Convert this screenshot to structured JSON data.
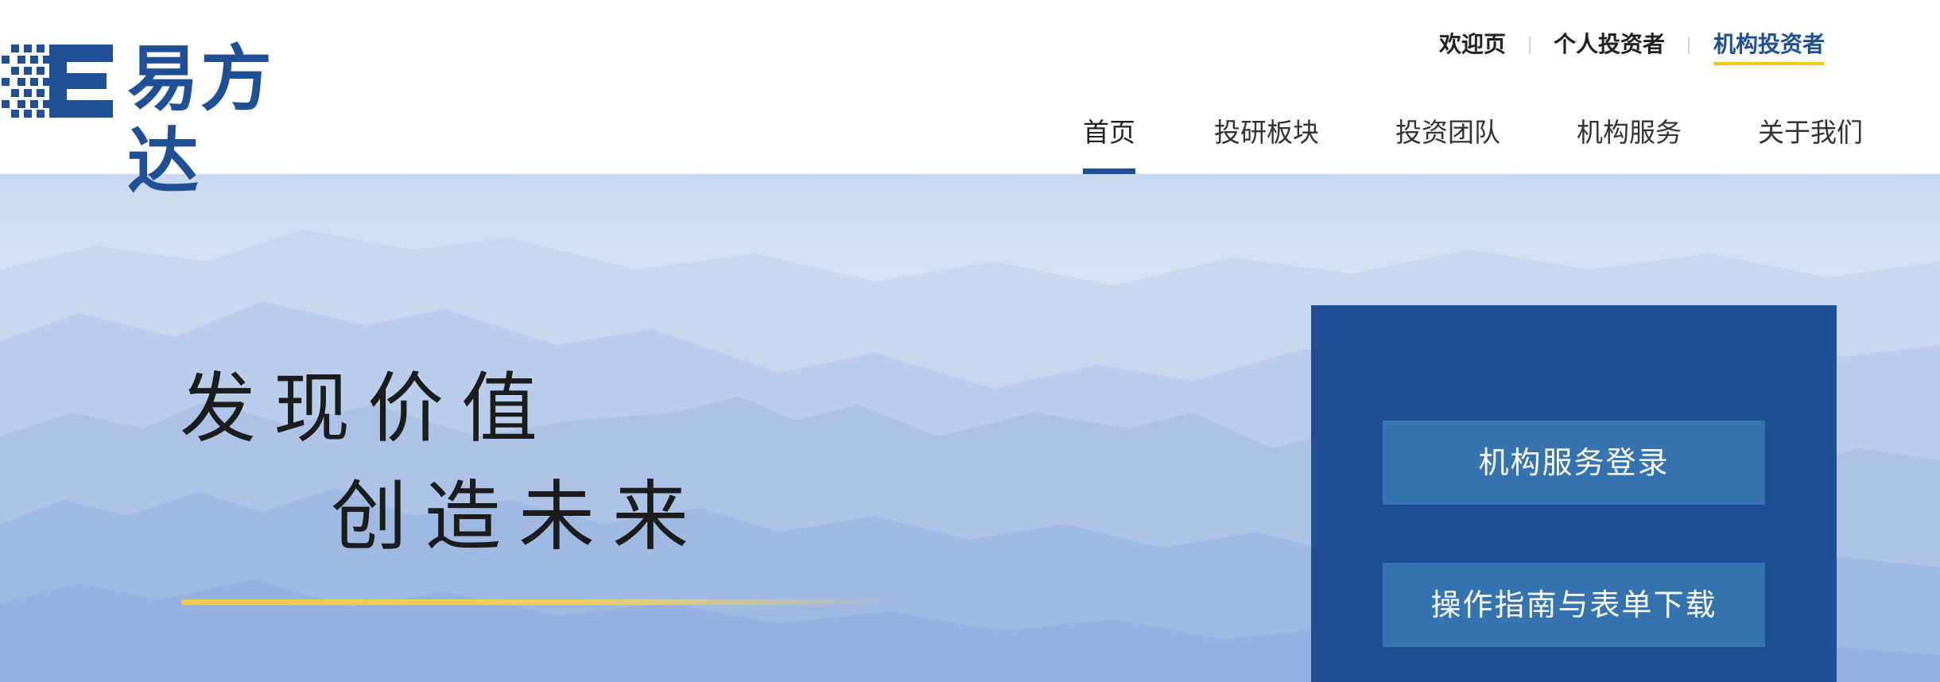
{
  "brand": {
    "name": "易方达",
    "color": "#1f4f95"
  },
  "top_links": [
    {
      "label": "欢迎页",
      "active": false
    },
    {
      "label": "个人投资者",
      "active": false
    },
    {
      "label": "机构投资者",
      "active": true
    }
  ],
  "main_nav": [
    {
      "label": "首页",
      "active": true
    },
    {
      "label": "投研板块",
      "active": false
    },
    {
      "label": "投资团队",
      "active": false
    },
    {
      "label": "机构服务",
      "active": false
    },
    {
      "label": "关于我们",
      "active": false
    }
  ],
  "hero": {
    "slogan_line1": "发现价值",
    "slogan_line2": "创造未来",
    "accent_color": "#f2c94c"
  },
  "service_panel": {
    "login_button": "机构服务登录",
    "guide_button": "操作指南与表单下载",
    "panel_color": "#1f4f93",
    "button_color": "#3574b0"
  },
  "icons": {
    "logo": "efund-logo-icon"
  }
}
